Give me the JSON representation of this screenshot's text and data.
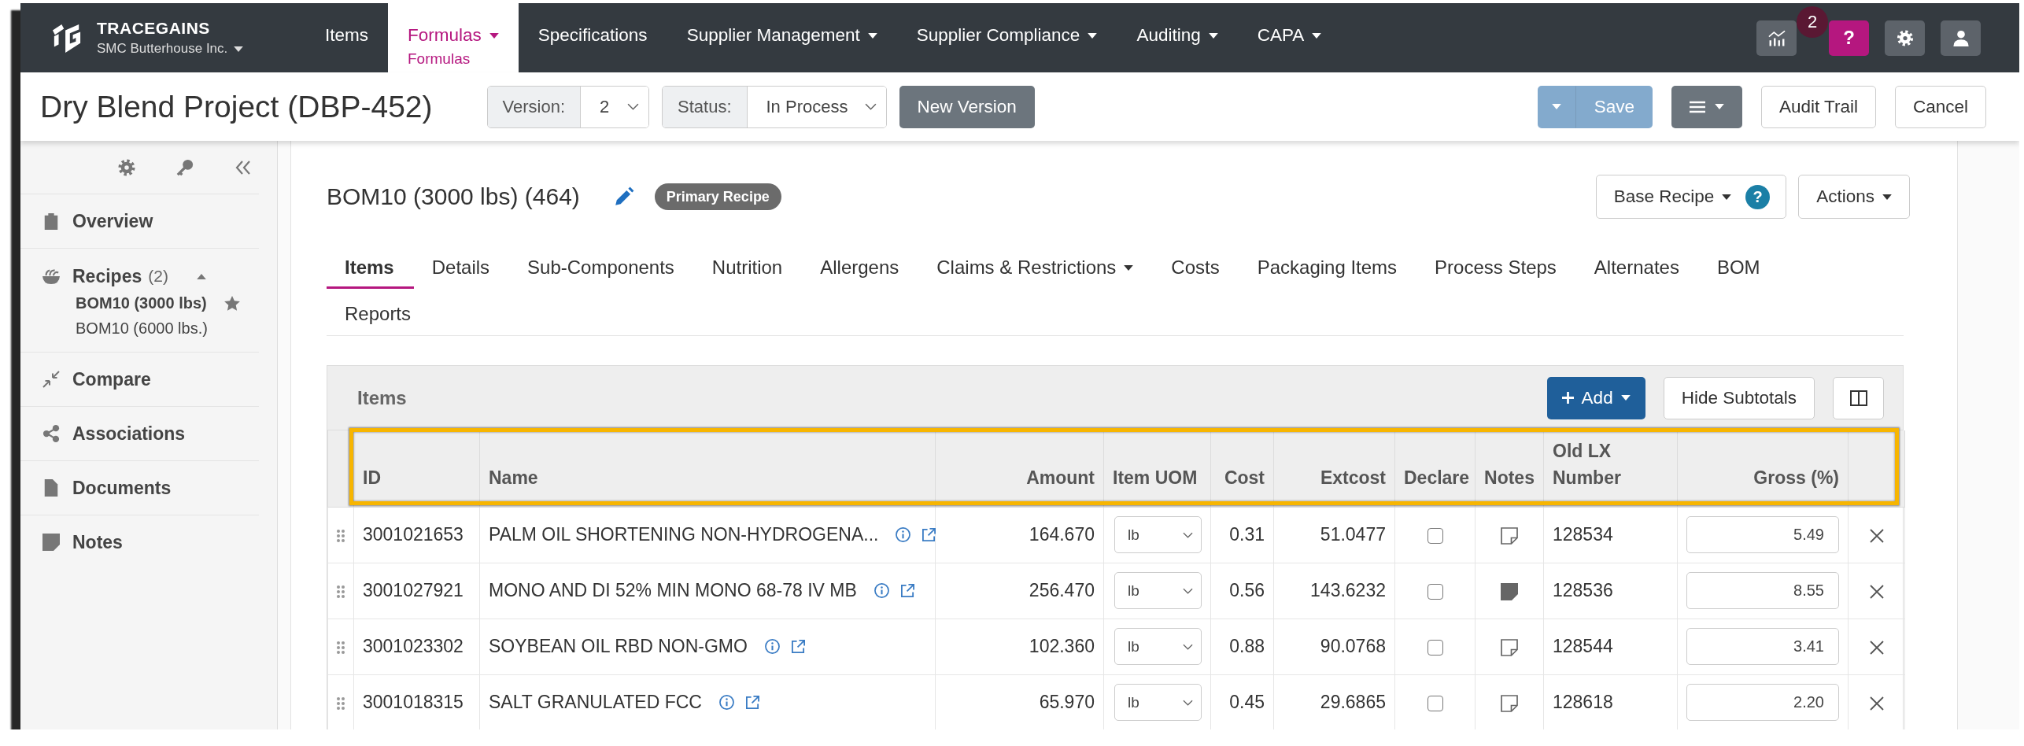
{
  "top_nav": {
    "brand": "TRACEGAINS",
    "company": "SMC Butterhouse Inc.",
    "items": [
      {
        "label": "Items",
        "selected": false,
        "dropdown": false
      },
      {
        "label": "Formulas",
        "sublabel": "Formulas",
        "selected": true,
        "dropdown": true
      },
      {
        "label": "Specifications",
        "selected": false,
        "dropdown": false
      },
      {
        "label": "Supplier Management",
        "selected": false,
        "dropdown": true
      },
      {
        "label": "Supplier Compliance",
        "selected": false,
        "dropdown": true
      },
      {
        "label": "Auditing",
        "selected": false,
        "dropdown": true
      },
      {
        "label": "CAPA",
        "selected": false,
        "dropdown": true
      }
    ],
    "help_button": "?",
    "help_badge": "2"
  },
  "header": {
    "title": "Dry Blend Project (DBP-452)",
    "version": {
      "label": "Version:",
      "value": "2"
    },
    "status": {
      "label": "Status:",
      "value": "In Process"
    },
    "new_version_button": "New Version",
    "save_button": {
      "label": "Save",
      "disabled": true
    },
    "audit_trail_button": "Audit Trail",
    "cancel_button": "Cancel"
  },
  "sidebar": {
    "items": [
      {
        "label": "Overview"
      },
      {
        "label": "Recipes",
        "count": "(2)",
        "expanded": true,
        "children": [
          {
            "label": "BOM10 (3000 lbs)",
            "selected": true,
            "starred": true
          },
          {
            "label": "BOM10 (6000 lbs.)",
            "selected": false,
            "starred": false
          }
        ]
      },
      {
        "label": "Compare"
      },
      {
        "label": "Associations"
      },
      {
        "label": "Documents"
      },
      {
        "label": "Notes"
      }
    ]
  },
  "content": {
    "heading": "BOM10 (3000 lbs) (464)",
    "badge": "Primary Recipe",
    "base_recipe_button": "Base Recipe",
    "base_recipe_help": "?",
    "actions_button": "Actions",
    "tabs": [
      {
        "label": "Items",
        "selected": true,
        "dropdown": false
      },
      {
        "label": "Details",
        "selected": false,
        "dropdown": false
      },
      {
        "label": "Sub-Components",
        "selected": false,
        "dropdown": false
      },
      {
        "label": "Nutrition",
        "selected": false,
        "dropdown": false
      },
      {
        "label": "Allergens",
        "selected": false,
        "dropdown": false
      },
      {
        "label": "Claims & Restrictions",
        "selected": false,
        "dropdown": true
      },
      {
        "label": "Costs",
        "selected": false,
        "dropdown": false
      },
      {
        "label": "Packaging Items",
        "selected": false,
        "dropdown": false
      },
      {
        "label": "Process Steps",
        "selected": false,
        "dropdown": false
      },
      {
        "label": "Alternates",
        "selected": false,
        "dropdown": false
      },
      {
        "label": "BOM",
        "selected": false,
        "dropdown": false
      },
      {
        "label": "Reports",
        "selected": false,
        "dropdown": false
      }
    ]
  },
  "items_panel": {
    "title": "Items",
    "add_button": "Add",
    "hide_subtotals_button": "Hide Subtotals",
    "table": {
      "header_highlighted": true,
      "columns": [
        "ID",
        "Name",
        "Amount",
        "Item UOM",
        "Cost",
        "Extcost",
        "Declare",
        "Notes",
        "Old LX Number",
        "Gross (%)"
      ],
      "rows": [
        {
          "id": "3001021653",
          "name": "PALM OIL SHORTENING NON-HYDROGENA...",
          "amount": "164.670",
          "uom": "lb",
          "cost": "0.31",
          "extcost": "51.0477",
          "declare": false,
          "has_note": false,
          "old_lx_number": "128534",
          "gross": "5.49"
        },
        {
          "id": "3001027921",
          "name": "MONO AND DI 52% MIN MONO 68-78 IV MB",
          "amount": "256.470",
          "uom": "lb",
          "cost": "0.56",
          "extcost": "143.6232",
          "declare": false,
          "has_note": true,
          "old_lx_number": "128536",
          "gross": "8.55"
        },
        {
          "id": "3001023302",
          "name": "SOYBEAN OIL RBD NON-GMO",
          "amount": "102.360",
          "uom": "lb",
          "cost": "0.88",
          "extcost": "90.0768",
          "declare": false,
          "has_note": false,
          "old_lx_number": "128544",
          "gross": "3.41"
        },
        {
          "id": "3001018315",
          "name": "SALT GRANULATED FCC",
          "amount": "65.970",
          "uom": "lb",
          "cost": "0.45",
          "extcost": "29.6865",
          "declare": false,
          "has_note": false,
          "old_lx_number": "128618",
          "gross": "2.20"
        }
      ]
    }
  }
}
